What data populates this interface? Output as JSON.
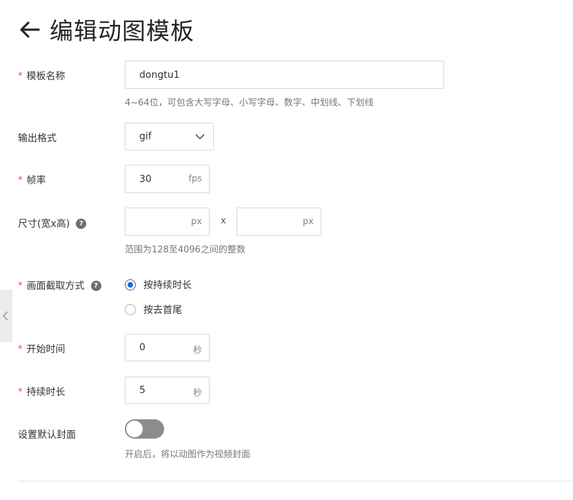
{
  "header": {
    "title": "编辑动图模板"
  },
  "form": {
    "name": {
      "label": "模板名称",
      "required_mark": "*",
      "value": "dongtu1",
      "hint": "4~64位，可包含大写字母、小写字母、数字、中划线、下划线"
    },
    "format": {
      "label": "输出格式",
      "value": "gif"
    },
    "fps": {
      "label": "帧率",
      "required_mark": "*",
      "value": "30",
      "unit": "fps"
    },
    "size": {
      "label": "尺寸(宽x高)",
      "help": "?",
      "width_value": "",
      "height_value": "",
      "unit": "px",
      "separator": "x",
      "hint": "范围为128至4096之间的整数"
    },
    "capture": {
      "label": "画面截取方式",
      "required_mark": "*",
      "help": "?",
      "options": [
        {
          "label": "按持续时长",
          "selected": true
        },
        {
          "label": "按去首尾",
          "selected": false
        }
      ]
    },
    "start_time": {
      "label": "开始时间",
      "required_mark": "*",
      "value": "0",
      "unit": "秒"
    },
    "duration": {
      "label": "持续时长",
      "required_mark": "*",
      "value": "5",
      "unit": "秒"
    },
    "default_cover": {
      "label": "设置默认封面",
      "enabled": false,
      "hint": "开启后，将以动图作为视频封面"
    }
  },
  "colors": {
    "accent": "#1f6ed4",
    "required": "#e64545",
    "toggle_off": "#8c8c8c"
  },
  "icons": {
    "back": "arrow-left-icon",
    "select": "chevron-down-icon",
    "help": "question-circle-icon",
    "side": "chevron-left-icon"
  }
}
